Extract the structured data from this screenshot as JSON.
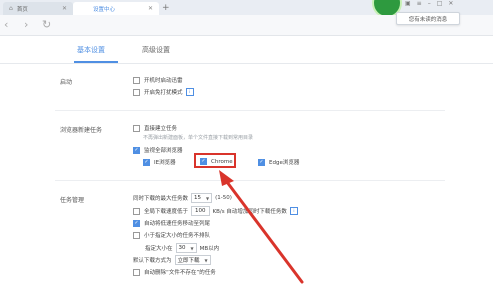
{
  "browser": {
    "tabs": [
      {
        "label": "首页"
      },
      {
        "label": "设置中心"
      }
    ],
    "tooltip": "您有未读的消息"
  },
  "settings_tabs": [
    "基本设置",
    "高级设置"
  ],
  "startup": {
    "title": "启动",
    "options": [
      {
        "label": "开机时启动迅雷",
        "checked": false
      },
      {
        "label": "开启免打扰模式",
        "checked": false
      }
    ]
  },
  "new_task": {
    "title": "浏览器新建任务",
    "direct_label": "直接建立任务",
    "direct_hint": "不再弹出新建面板，单个文件直接下载到常用目录",
    "monitor_label": "监视全部浏览器",
    "browsers": [
      {
        "label": "IE浏览器",
        "checked": true
      },
      {
        "label": "Chrome",
        "checked": true
      },
      {
        "label": "Edge浏览器",
        "checked": true
      }
    ]
  },
  "task_mgmt": {
    "title": "任务管理",
    "max_downloads_label": "同时下载的最大任务数",
    "max_downloads_value": "15",
    "max_downloads_range": "(1-50)",
    "speed_limit_prefix": "全局下载速度低于",
    "speed_limit_value": "100",
    "speed_limit_suffix": "KB/s 自动增加同时下载任务数",
    "move_low_speed": "自动将低速任务移动至列尾",
    "small_file_label": "小于指定大小的任务不排队",
    "size_prefix": "指定大小在",
    "size_value": "30",
    "size_suffix": "MB以内",
    "default_mode_label": "默认下载方式为",
    "default_mode_value": "立即下载",
    "auto_delete": "自动删除“文件不存在”的任务"
  },
  "colors": {
    "accent": "#4f8fe3",
    "annotation": "#d9342b"
  }
}
